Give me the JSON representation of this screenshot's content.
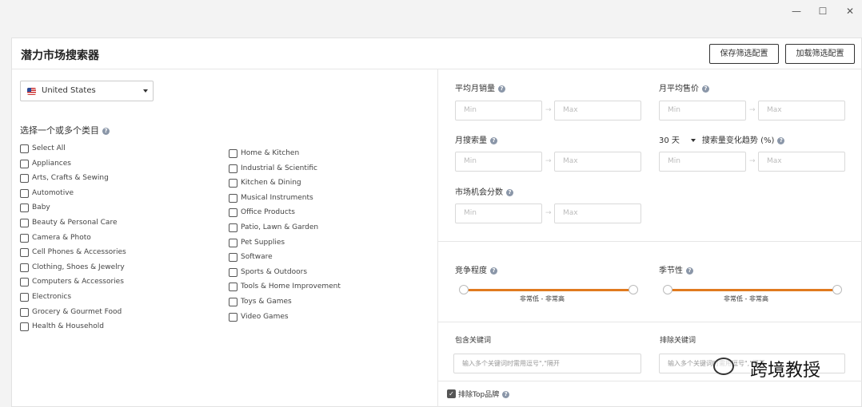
{
  "window": {
    "minimize": "—",
    "maximize": "☐",
    "close": "✕"
  },
  "header": {
    "title": "潜力市场搜索器",
    "save_config": "保存筛选配置",
    "load_config": "加载筛选配置"
  },
  "country": {
    "selected": "United States"
  },
  "categories": {
    "title": "选择一个或多个类目",
    "col1": [
      "Select All",
      "Appliances",
      "Arts, Crafts & Sewing",
      "Automotive",
      "Baby",
      "Beauty & Personal Care",
      "Camera & Photo",
      "Cell Phones & Accessories",
      "Clothing, Shoes & Jewelry",
      "Computers & Accessories",
      "Electronics",
      "Grocery & Gourmet Food",
      "Health & Household"
    ],
    "col2": [
      "Home & Kitchen",
      "Industrial & Scientific",
      "Kitchen & Dining",
      "Musical Instruments",
      "Office Products",
      "Patio, Lawn & Garden",
      "Pet Supplies",
      "Software",
      "Sports & Outdoors",
      "Tools & Home Improvement",
      "Toys & Games",
      "Video Games"
    ]
  },
  "filters": {
    "avg_monthly_sales": "平均月销量",
    "avg_monthly_price": "月平均售价",
    "monthly_search": "月搜索量",
    "days": "30 天",
    "search_trend": "搜索量变化趋势 (%)",
    "opportunity_score": "市场机会分数",
    "min_placeholder": "Min",
    "max_placeholder": "Max",
    "arrow": "→"
  },
  "sliders": {
    "competition": {
      "label": "竞争程度",
      "range_text": "非常低  -  非常高",
      "low": 0,
      "high": 1
    },
    "seasonality": {
      "label": "季节性",
      "range_text": "非常低  -  非常高",
      "low": 0,
      "high": 1
    }
  },
  "keywords": {
    "include_label": "包含关键词",
    "exclude_label": "排除关键词",
    "include_placeholder": "输入多个关键词时需用逗号\",\"隔开",
    "exclude_placeholder": "输入多个关键词时需用逗号\",\"隔开"
  },
  "exclude_top_brand": {
    "label": "排除Top品牌",
    "checked": true
  },
  "watermark": {
    "text": "跨境教授"
  }
}
